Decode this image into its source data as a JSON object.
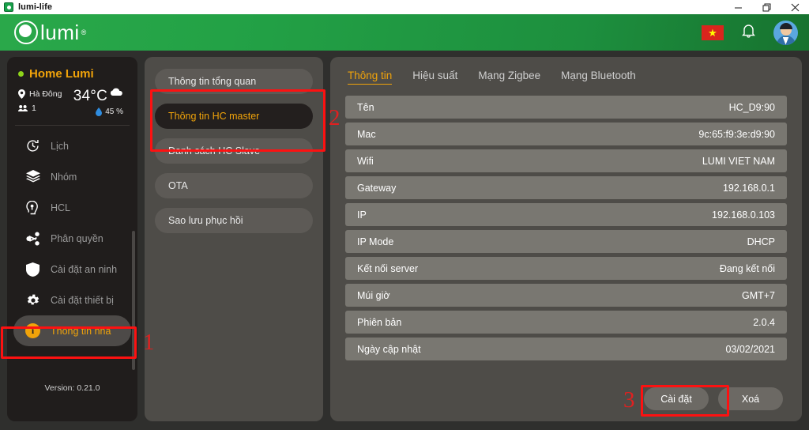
{
  "window": {
    "title": "lumi-life",
    "app_icon": "lumi-app-icon",
    "controls": {
      "minimize": "minimize-icon",
      "maximize": "maximize-icon",
      "close": "close-icon"
    }
  },
  "appbar": {
    "brand": "lumi",
    "trademark": "®",
    "flag": "vietnam-flag",
    "flag_star": "★",
    "notification": "bell-icon",
    "avatar": "user-avatar"
  },
  "sidebar": {
    "home_name": "Home Lumi",
    "location": "Hà Đông",
    "members": "1",
    "temperature": "34°C",
    "humidity": "45 %",
    "weather_icon": "cloud-icon",
    "nav": [
      {
        "label": "Lịch",
        "icon": "clock-icon",
        "active": false
      },
      {
        "label": "Nhóm",
        "icon": "layers-icon",
        "active": false
      },
      {
        "label": "HCL",
        "icon": "head-bulb-icon",
        "active": false
      },
      {
        "label": "Phân quyền",
        "icon": "share-icon",
        "active": false
      },
      {
        "label": "Cài đặt an ninh",
        "icon": "shield-icon",
        "active": false
      },
      {
        "label": "Cài đặt thiết bị",
        "icon": "gear-icon",
        "active": false
      },
      {
        "label": "Thông tin nhà",
        "icon": "info-icon",
        "active": true
      }
    ],
    "version": "Version: 0.21.0"
  },
  "midpanel": {
    "items": [
      {
        "label": "Thông tin tổng quan",
        "selected": false
      },
      {
        "label": "Thông tin HC master",
        "selected": true
      },
      {
        "label": "Danh sách HC Slave",
        "selected": false
      },
      {
        "label": "OTA",
        "selected": false
      },
      {
        "label": "Sao lưu phục hồi",
        "selected": false
      }
    ]
  },
  "main": {
    "tabs": [
      {
        "label": "Thông tin",
        "active": true
      },
      {
        "label": "Hiệu suất",
        "active": false
      },
      {
        "label": "Mạng Zigbee",
        "active": false
      },
      {
        "label": "Mạng Bluetooth",
        "active": false
      }
    ],
    "rows": [
      {
        "label": "Tên",
        "value": "HC_D9:90"
      },
      {
        "label": "Mac",
        "value": "9c:65:f9:3e:d9:90"
      },
      {
        "label": "Wifi",
        "value": "LUMI VIET NAM"
      },
      {
        "label": "Gateway",
        "value": "192.168.0.1"
      },
      {
        "label": "IP",
        "value": "192.168.0.103"
      },
      {
        "label": "IP Mode",
        "value": "DHCP"
      },
      {
        "label": "Kết nối server",
        "value": "Đang kết nối"
      },
      {
        "label": "Múi giờ",
        "value": "GMT+7"
      },
      {
        "label": "Phiên bản",
        "value": "2.0.4"
      },
      {
        "label": "Ngày cập nhật",
        "value": "03/02/2021"
      }
    ],
    "actions": [
      {
        "label": "Cài đặt"
      },
      {
        "label": "Xoá"
      }
    ]
  },
  "annotations": {
    "one": "1",
    "two": "2",
    "three": "3",
    "color": "#fd1111"
  }
}
